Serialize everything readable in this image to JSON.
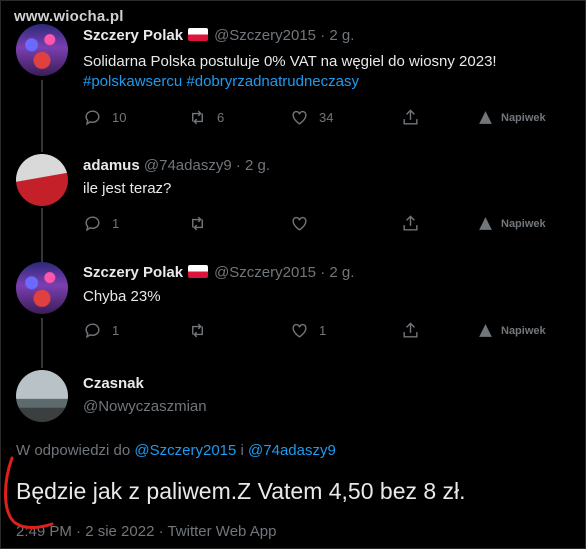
{
  "watermark": "www.wiocha.pl",
  "tweets": [
    {
      "name": "Szczery Polak",
      "handle": "@Szczery2015",
      "time": "· 2 g.",
      "text": "Solidarna Polska postuluje 0% VAT na węgiel do wiosny 2023!",
      "hashtags": "#polskawsercu #dobryrzadnatrudneczasy",
      "replies": "10",
      "retweets": "6",
      "likes": "34",
      "tip": "Napiwek"
    },
    {
      "name": "adamus",
      "handle": "@74adaszy9",
      "time": "· 2 g.",
      "text": "ile jest teraz?",
      "replies": "1",
      "retweets": "",
      "likes": "",
      "tip": "Napiwek"
    },
    {
      "name": "Szczery Polak",
      "handle": "@Szczery2015",
      "time": "· 2 g.",
      "text": "Chyba 23%",
      "replies": "1",
      "retweets": "",
      "likes": "1",
      "tip": "Napiwek"
    }
  ],
  "main": {
    "name": "Czasnak",
    "handle": "@Nowyczaszmian",
    "reply_prefix": "W odpowiedzi do",
    "reply_user1": "@Szczery2015",
    "reply_and": "i",
    "reply_user2": "@74adaszy9",
    "text": "Będzie jak z paliwem.Z Vatem 4,50 bez 8 zł.",
    "meta": "2:49 PM · 2 sie 2022 · Twitter Web App"
  },
  "colors": {
    "link": "#1d9bf0",
    "muted": "#71767b",
    "text": "#e7e9ea",
    "background": "#000000",
    "annotation": "#e0201a"
  }
}
